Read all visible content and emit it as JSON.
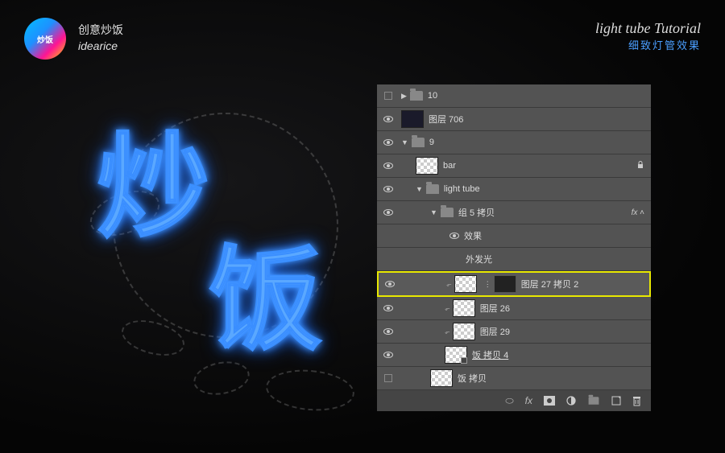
{
  "brand": {
    "cn": "创意炒饭",
    "en": "idearice",
    "logo": "炒饭"
  },
  "tutorial": {
    "title": "light tube Tutorial",
    "subtitle": "细致灯管效果"
  },
  "neon": {
    "char1": "炒",
    "char2": "饭"
  },
  "layers": {
    "items": [
      {
        "name": "10",
        "type": "folder",
        "vis": "square",
        "indent": 0,
        "collapsed": true
      },
      {
        "name": "图层 706",
        "type": "layer",
        "vis": "eye",
        "indent": 0,
        "thumb": "dark"
      },
      {
        "name": "9",
        "type": "folder",
        "vis": "eye",
        "indent": 0,
        "collapsed": false
      },
      {
        "name": "bar",
        "type": "layer",
        "vis": "eye",
        "indent": 1,
        "thumb": "checker",
        "locked": true
      },
      {
        "name": "light tube",
        "type": "folder",
        "vis": "eye",
        "indent": 1,
        "collapsed": false
      },
      {
        "name": "组 5 拷贝",
        "type": "folder",
        "vis": "eye",
        "indent": 2,
        "collapsed": false,
        "fx": true
      },
      {
        "name": "效果",
        "type": "effects",
        "vis": "",
        "indent": 3
      },
      {
        "name": "外发光",
        "type": "effect_item",
        "vis": "",
        "indent": 3
      },
      {
        "name": "图层 27 拷贝 2",
        "type": "layer",
        "vis": "eye",
        "indent": 3,
        "thumb": "checker",
        "mask": true,
        "clipped": true,
        "selected": true
      },
      {
        "name": "图层 26",
        "type": "layer",
        "vis": "eye",
        "indent": 3,
        "thumb": "checker",
        "clipped": true
      },
      {
        "name": "图层 29",
        "type": "layer",
        "vis": "eye",
        "indent": 3,
        "thumb": "checker",
        "clipped": true
      },
      {
        "name": "饭 拷贝 4",
        "type": "layer",
        "vis": "eye",
        "indent": 3,
        "thumb": "checker",
        "smart": true,
        "underline": true
      },
      {
        "name": "饭 拷贝",
        "type": "layer",
        "vis": "square",
        "indent": 2,
        "thumb": "checker"
      }
    ]
  },
  "footer": {
    "icons": [
      "link",
      "fx",
      "mask",
      "adjust",
      "group",
      "new",
      "trash"
    ]
  }
}
